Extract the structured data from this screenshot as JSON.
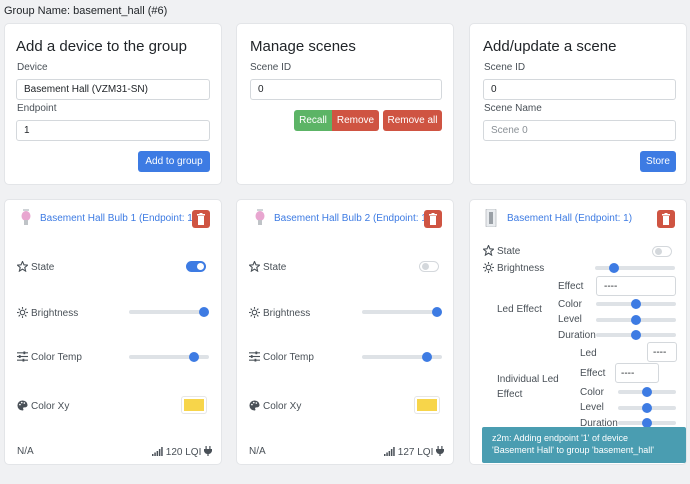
{
  "group_name": "Group Name: basement_hall (#6)",
  "add_device": {
    "title": "Add a device to the group",
    "device_label": "Device",
    "device_value": "Basement Hall (VZM31-SN)",
    "endpoint_label": "Endpoint",
    "endpoint_value": "1",
    "button": "Add to group"
  },
  "manage_scenes": {
    "title": "Manage scenes",
    "scene_id_label": "Scene ID",
    "scene_id_value": "0",
    "recall": "Recall",
    "remove": "Remove",
    "remove_all": "Remove all"
  },
  "add_scene": {
    "title": "Add/update a scene",
    "scene_id_label": "Scene ID",
    "scene_id_value": "0",
    "scene_name_label": "Scene Name",
    "scene_name_placeholder": "Scene 0",
    "button": "Store"
  },
  "bulb1": {
    "name": "Basement Hall Bulb 1 (Endpoint: 11)",
    "state": "State",
    "state_on": true,
    "brightness": "Brightness",
    "brightness_level": 1.0,
    "color_temp": "Color Temp",
    "color_temp_level": 0.85,
    "color_xy": "Color Xy",
    "color": "#f7d54a",
    "footer_left": "N/A",
    "lqi": "120 LQI"
  },
  "bulb2": {
    "name": "Basement Hall Bulb 2 (Endpoint: 11)",
    "state": "State",
    "state_on": false,
    "brightness": "Brightness",
    "brightness_level": 1.0,
    "color_temp": "Color Temp",
    "color_temp_level": 0.85,
    "color_xy": "Color Xy",
    "color": "#f7d54a",
    "footer_left": "N/A",
    "lqi": "127 LQI"
  },
  "switch": {
    "name": "Basement Hall (Endpoint: 1)",
    "state": "State",
    "brightness": "Brightness",
    "brightness_level": 0.2,
    "led_effect": "Led Effect",
    "effect_label": "Effect",
    "effect_value": "----",
    "color_label": "Color",
    "color_level": 0.5,
    "level_label": "Level",
    "level_level": 0.5,
    "duration_label": "Duration",
    "duration_level": 0.5,
    "individual_led_effect_line1": "Individual Led",
    "individual_led_effect_line2": "Effect",
    "led_label": "Led",
    "led_value": "----",
    "ind_effect_label": "Effect",
    "ind_effect_value": "----",
    "ind_color_label": "Color",
    "ind_color_level": 0.5,
    "ind_level_label": "Level",
    "ind_level_level": 0.5,
    "ind_duration_label": "Duration",
    "ind_duration_level": 0.5
  },
  "toast": {
    "line1": "z2m: Adding endpoint '1' of device",
    "line2": "'Basement Hall' to group 'basement_hall'"
  },
  "colors": {
    "primary": "#3d7be3",
    "success": "#5cb466",
    "danger": "#cf5442",
    "toast": "#4a9db1"
  }
}
